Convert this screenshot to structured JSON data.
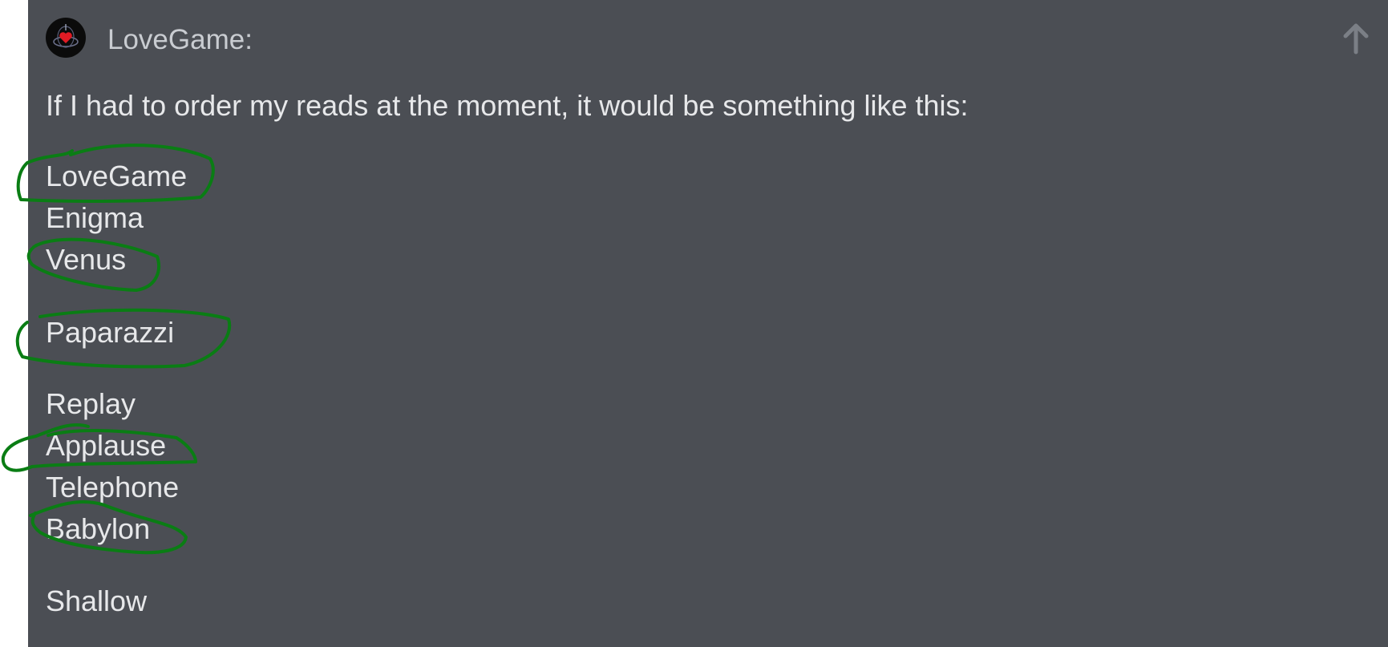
{
  "post": {
    "username": "LoveGame:",
    "intro": "If I had to order my reads at the moment, it would be something like this:",
    "reads": [
      {
        "name": "LoveGame",
        "circled": true
      },
      {
        "name": "Enigma",
        "circled": false
      },
      {
        "name": "Venus",
        "circled": true
      },
      {
        "name": "Paparazzi",
        "circled": true
      },
      {
        "name": "Replay",
        "circled": false
      },
      {
        "name": "Applause",
        "circled": true
      },
      {
        "name": "Telephone",
        "circled": false
      },
      {
        "name": "Babylon",
        "circled": true
      },
      {
        "name": "Shallow",
        "circled": false
      }
    ]
  },
  "icons": {
    "avatar": "avatar-heart-logo",
    "scroll_up": "arrow-up-icon"
  },
  "colors": {
    "panel_bg": "#4b4e54",
    "text": "#e7e8ea",
    "username": "#c9ccd1",
    "annotation": "#0a7d14",
    "arrow": "#7b7f86"
  }
}
